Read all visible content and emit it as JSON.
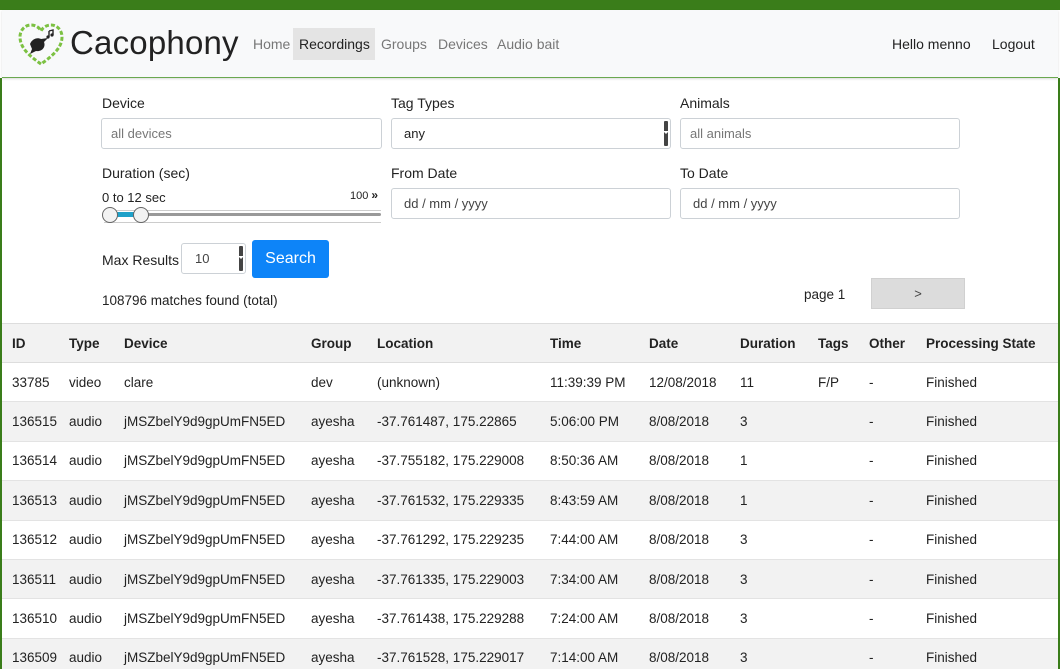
{
  "brand": {
    "name": "Cacophony",
    "logo": "cacophony-heart-bird-logo"
  },
  "nav": {
    "links": [
      "Home",
      "Recordings",
      "Groups",
      "Devices",
      "Audio bait"
    ],
    "active": "Recordings",
    "greeting": "Hello menno",
    "logout": "Logout"
  },
  "filters": {
    "device_label": "Device",
    "device_placeholder": "all devices",
    "tag_types_label": "Tag Types",
    "tag_types_value": "any",
    "animals_label": "Animals",
    "animals_placeholder": "all animals",
    "duration_label": "Duration (sec)",
    "duration_range_text": "0 to 12 sec",
    "duration_max": "100",
    "duration_min_value": 0,
    "duration_max_value": 12,
    "from_date_label": "From Date",
    "from_date_placeholder": "dd / mm / yyyy",
    "to_date_label": "To Date",
    "to_date_placeholder": "dd / mm / yyyy",
    "max_results_label": "Max Results",
    "max_results_value": "10",
    "search_button": "Search"
  },
  "summary": {
    "matches": "108796 matches found (total)",
    "page": "page 1",
    "next": ">"
  },
  "table": {
    "headers": [
      "ID",
      "Type",
      "Device",
      "Group",
      "Location",
      "Time",
      "Date",
      "Duration",
      "Tags",
      "Other",
      "Processing State"
    ],
    "rows": [
      {
        "id": "33785",
        "type": "video",
        "device": "clare",
        "group": "dev",
        "location": "(unknown)",
        "time": "11:39:39 PM",
        "date": "12/08/2018",
        "duration": "11",
        "tags": "F/P",
        "other": "-",
        "state": "Finished"
      },
      {
        "id": "136515",
        "type": "audio",
        "device": "jMSZbelY9d9gpUmFN5ED",
        "group": "ayesha",
        "location": "-37.761487, 175.22865",
        "time": "5:06:00 PM",
        "date": "8/08/2018",
        "duration": "3",
        "tags": "",
        "other": "-",
        "state": "Finished"
      },
      {
        "id": "136514",
        "type": "audio",
        "device": "jMSZbelY9d9gpUmFN5ED",
        "group": "ayesha",
        "location": "-37.755182, 175.229008",
        "time": "8:50:36 AM",
        "date": "8/08/2018",
        "duration": "1",
        "tags": "",
        "other": "-",
        "state": "Finished"
      },
      {
        "id": "136513",
        "type": "audio",
        "device": "jMSZbelY9d9gpUmFN5ED",
        "group": "ayesha",
        "location": "-37.761532, 175.229335",
        "time": "8:43:59 AM",
        "date": "8/08/2018",
        "duration": "1",
        "tags": "",
        "other": "-",
        "state": "Finished"
      },
      {
        "id": "136512",
        "type": "audio",
        "device": "jMSZbelY9d9gpUmFN5ED",
        "group": "ayesha",
        "location": "-37.761292, 175.229235",
        "time": "7:44:00 AM",
        "date": "8/08/2018",
        "duration": "3",
        "tags": "",
        "other": "-",
        "state": "Finished"
      },
      {
        "id": "136511",
        "type": "audio",
        "device": "jMSZbelY9d9gpUmFN5ED",
        "group": "ayesha",
        "location": "-37.761335, 175.229003",
        "time": "7:34:00 AM",
        "date": "8/08/2018",
        "duration": "3",
        "tags": "",
        "other": "-",
        "state": "Finished"
      },
      {
        "id": "136510",
        "type": "audio",
        "device": "jMSZbelY9d9gpUmFN5ED",
        "group": "ayesha",
        "location": "-37.761438, 175.229288",
        "time": "7:24:00 AM",
        "date": "8/08/2018",
        "duration": "3",
        "tags": "",
        "other": "-",
        "state": "Finished"
      },
      {
        "id": "136509",
        "type": "audio",
        "device": "jMSZbelY9d9gpUmFN5ED",
        "group": "ayesha",
        "location": "-37.761528, 175.229017",
        "time": "7:14:00 AM",
        "date": "8/08/2018",
        "duration": "3",
        "tags": "",
        "other": "-",
        "state": "Finished"
      }
    ]
  },
  "colors": {
    "brand_green": "#3a7d1a",
    "primary_blue": "#0d84f8",
    "link_blue": "#1a73c5",
    "tag_red": "#d9262c"
  }
}
